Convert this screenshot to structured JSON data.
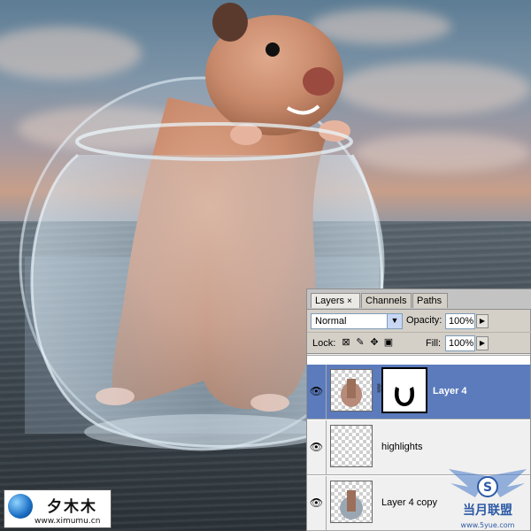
{
  "panel": {
    "tabs": [
      {
        "label": "Layers",
        "close": "×",
        "active": true
      },
      {
        "label": "Channels",
        "active": false
      },
      {
        "label": "Paths",
        "active": false
      }
    ],
    "blend_mode": "Normal",
    "opacity_label": "Opacity:",
    "opacity_value": "100%",
    "lock_label": "Lock:",
    "fill_label": "Fill:",
    "fill_value": "100%",
    "layers": [
      {
        "name": "Layer 4",
        "selected": true,
        "visible": true,
        "has_mask": true
      },
      {
        "name": "highlights",
        "selected": false,
        "visible": true,
        "has_mask": false
      },
      {
        "name": "Layer 4 copy",
        "selected": false,
        "visible": true,
        "has_mask": false
      }
    ]
  },
  "watermark": {
    "logo_text": "夕木木",
    "logo_url": "www.ximumu.cn",
    "site_text": "当月联盟",
    "site_url": "www.5yue.com"
  },
  "colors": {
    "selected_layer": "#5b7bbc",
    "panel_bg": "#d4d0c8"
  }
}
